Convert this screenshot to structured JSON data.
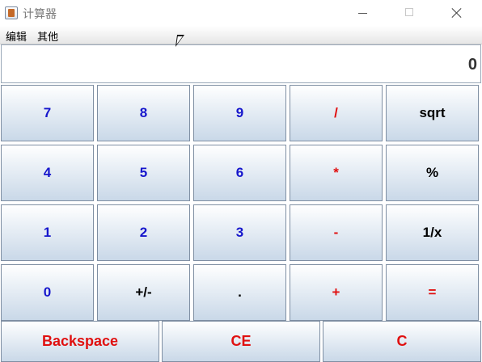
{
  "window": {
    "title": "计算器"
  },
  "menu": {
    "edit": "编辑",
    "other": "其他"
  },
  "display": {
    "value": "0"
  },
  "keys": {
    "seven": "7",
    "eight": "8",
    "nine": "9",
    "divide": "/",
    "sqrt": "sqrt",
    "four": "4",
    "five": "5",
    "six": "6",
    "multiply": "*",
    "percent": "%",
    "one": "1",
    "two": "2",
    "three": "3",
    "minus": "-",
    "reciprocal": "1/x",
    "zero": "0",
    "sign": "+/-",
    "dot": ".",
    "plus": "+",
    "equals": "=",
    "backspace": "Backspace",
    "ce": "CE",
    "c": "C"
  },
  "colors": {
    "digit": "#1616cc",
    "operator": "#e01010",
    "function": "#000000"
  },
  "icons": {
    "app": "java-cup-icon",
    "minimize": "minimize-icon",
    "maximize": "maximize-icon",
    "close": "close-icon",
    "cursor": "mouse-pointer-icon"
  }
}
